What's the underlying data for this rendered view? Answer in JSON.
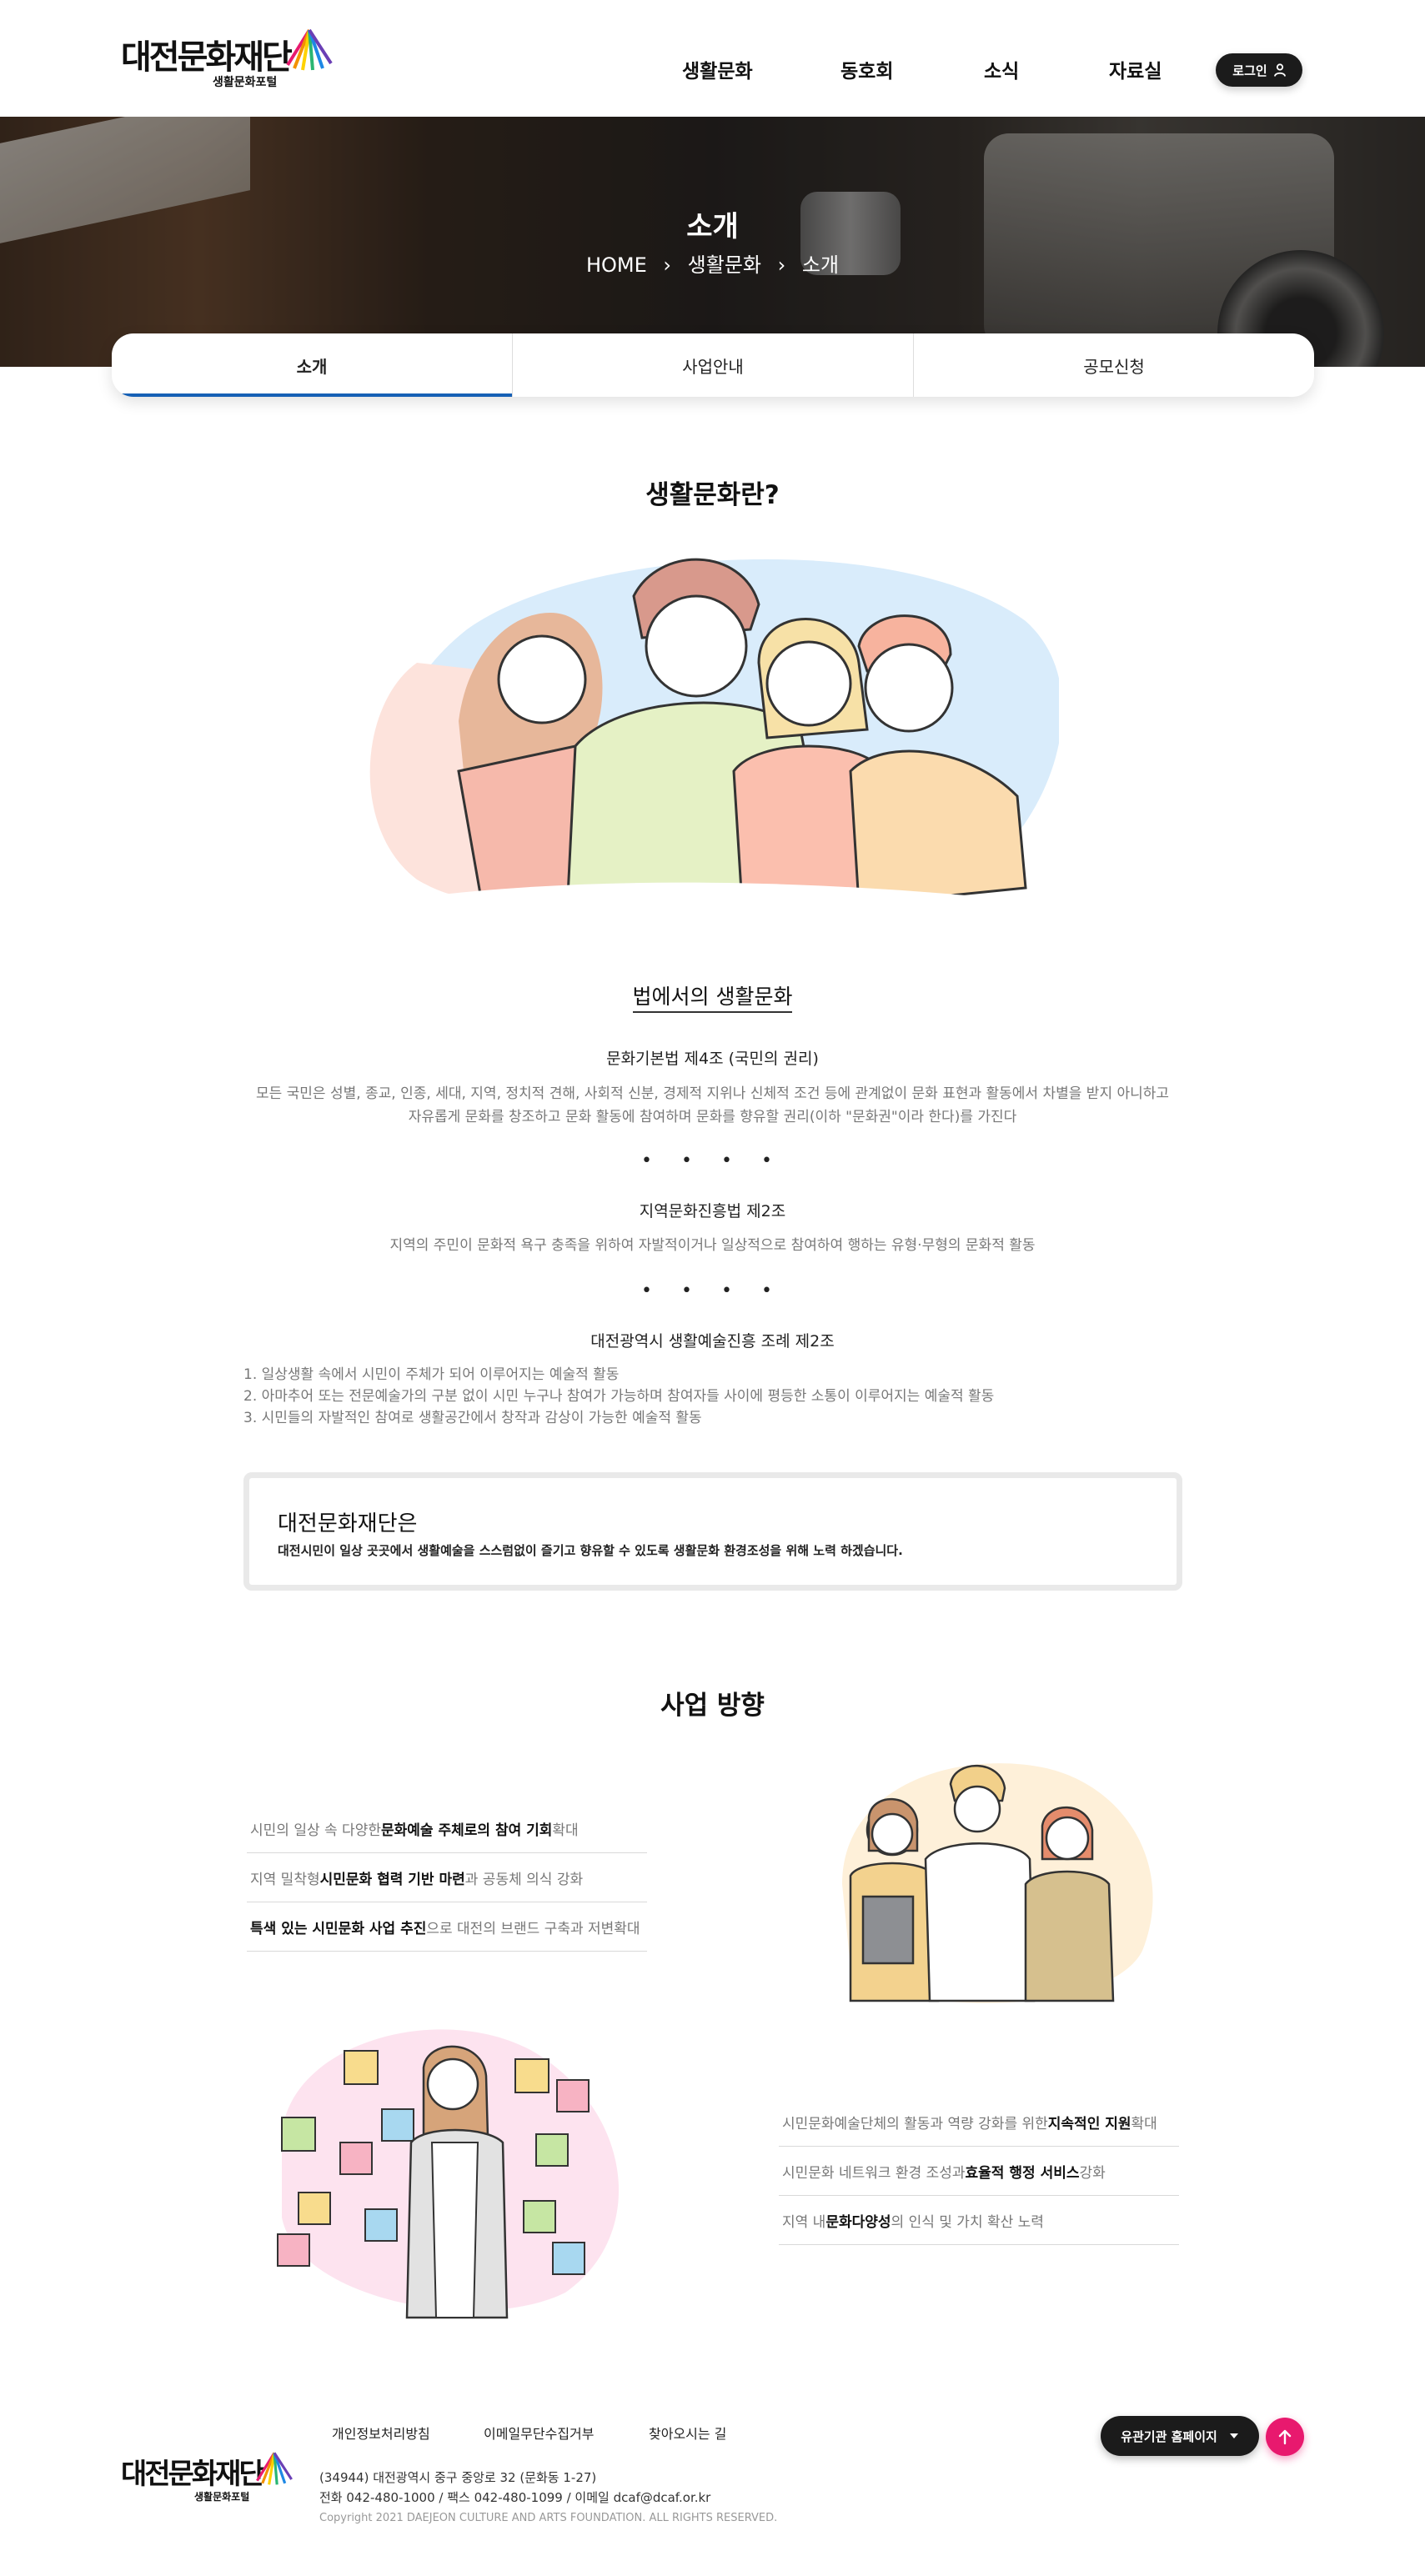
{
  "header": {
    "logo_text": "대전문화재단",
    "logo_sub": "생활문화포털",
    "nav": [
      "생활문화",
      "동호회",
      "소식",
      "자료실"
    ],
    "login_label": "로그인"
  },
  "hero": {
    "title": "소개",
    "breadcrumb": [
      "HOME",
      "생활문화",
      "소개"
    ]
  },
  "tabs": [
    "소개",
    "사업안내",
    "공모신청"
  ],
  "intro": {
    "title": "생활문화란?",
    "law_title": "법에서의 생활문화",
    "laws": [
      {
        "title": "문화기본법 제4조 (국민의 권리)",
        "text": [
          "모든 국민은 성별, 종교, 인종, 세대, 지역, 정치적 견해, 사회적 신분, 경제적 지위나 신체적 조건 등에 관계없이 문화 표현과 활동에서 차별을 받지 아니하고",
          "자유롭게 문화를 창조하고 문화 활동에 참여하며 문화를 향유할 권리(이하 \"문화권\"이라 한다)를 가진다"
        ]
      },
      {
        "title": "지역문화진흥법 제2조",
        "text": [
          "지역의 주민이 문화적 욕구 충족을 위하여 자발적이거나 일상적으로 참여하여 행하는 유형·무형의 문화적 활동"
        ]
      },
      {
        "title": "대전광역시 생활예술진흥 조례 제2조",
        "list": [
          "1. 일상생활 속에서 시민이 주체가 되어 이루어지는 예술적 활동",
          "2. 아마추어 또는 전문예술가의 구분 없이 시민 누구나 참여가 가능하며 참여자들 사이에 평등한 소통이 이루어지는 예술적 활동",
          "3. 시민들의 자발적인 참여로 생활공간에서 창작과 감상이 가능한 예술적 활동"
        ]
      }
    ],
    "dots": "• • • •",
    "box_title": "대전문화재단은",
    "box_text": "대전시민이 일상 곳곳에서 생활예술을 스스럼없이 즐기고 향유할 수 있도록 생활문화 환경조성을 위해 노력 하겠습니다."
  },
  "direction": {
    "title": "사업 방향",
    "left_items": [
      {
        "pre": "시민의 일상 속 다양한 ",
        "bold": "문화예술 주체로의 참여 기회",
        "post": " 확대"
      },
      {
        "pre": "지역 밀착형 ",
        "bold": "시민문화 협력 기반 마련",
        "post": "과 공동체 의식 강화"
      },
      {
        "pre": "",
        "bold": "특색 있는 시민문화 사업 추진",
        "post": "으로 대전의 브랜드 구축과 저변확대"
      }
    ],
    "right_items": [
      {
        "pre": "시민문화예술단체의 활동과 역량 강화를 위한 ",
        "bold": "지속적인 지원",
        "post": " 확대"
      },
      {
        "pre": "시민문화 네트워크 환경 조성과 ",
        "bold": "효율적 행정 서비스",
        "post": " 강화"
      },
      {
        "pre": "지역 내 ",
        "bold": "문화다양성",
        "post": "의 인식 및 가치 확산 노력"
      }
    ]
  },
  "footer": {
    "links": [
      "개인정보처리방침",
      "이메일무단수집거부",
      "찾아오시는 길"
    ],
    "logo_text": "대전문화재단",
    "logo_sub": "생활문화포털",
    "address": "(34944) 대전광역시 중구 중앙로 32 (문화동 1-27)",
    "contact": "전화 042-480-1000 / 팩스 042-480-1099 / 이메일 dcaf@dcaf.or.kr",
    "copyright": "Copyright 2021 DAEJEON CULTURE AND ARTS FOUNDATION. ALL RIGHTS RESERVED.",
    "family_label": "유관기관 홈페이지"
  },
  "colors": {
    "accent_tab": "#1660b5",
    "top_button": "#e8196e",
    "dark_button": "#1b1b1b"
  },
  "icons": [
    "user-icon",
    "caret-down-icon",
    "arrow-up-icon",
    "chevron-right-icon"
  ]
}
